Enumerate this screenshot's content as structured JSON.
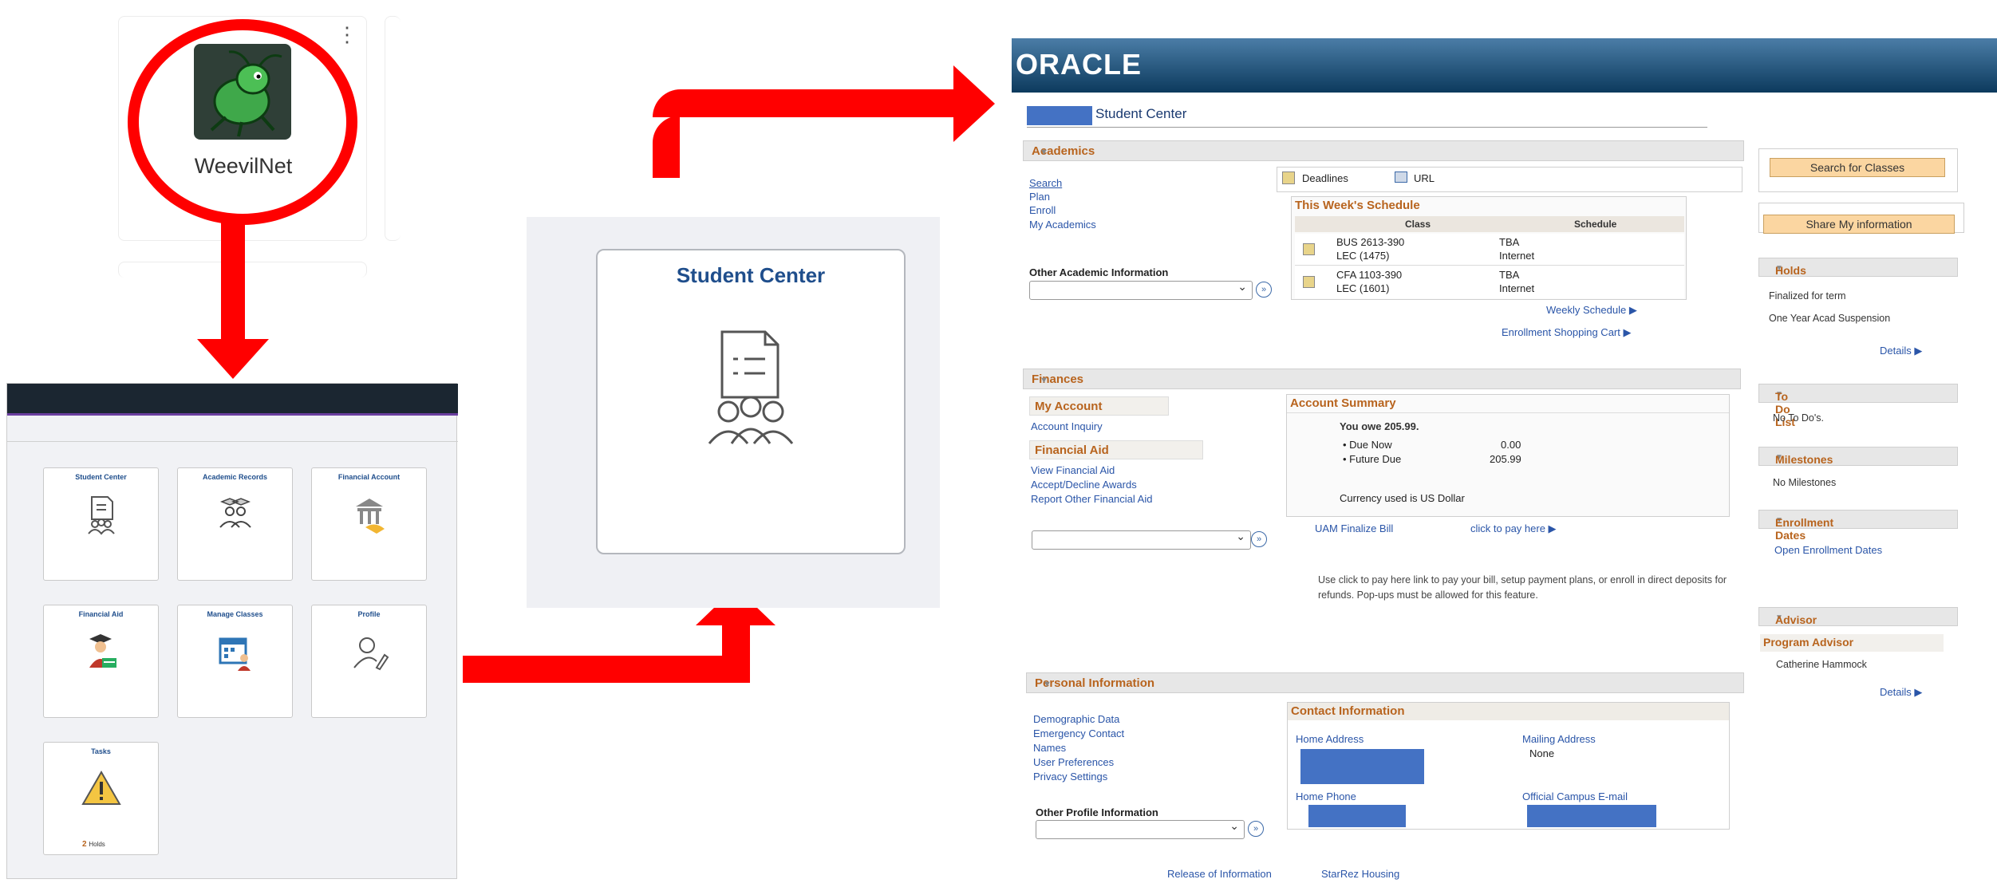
{
  "app_launcher": {
    "app_name": "WeevilNet"
  },
  "fluid_home": {
    "tiles": [
      {
        "title": "Student Center"
      },
      {
        "title": "Academic Records"
      },
      {
        "title": "Financial Account"
      },
      {
        "title": "Financial Aid"
      },
      {
        "title": "Manage Classes"
      },
      {
        "title": "Profile"
      },
      {
        "title": "Tasks",
        "count": "2",
        "count_label": "Holds"
      }
    ]
  },
  "middle_card": {
    "title": "Student Center"
  },
  "oracle": {
    "logo": "ORACLE",
    "page_title": "Student Center",
    "academics": {
      "header": "Academics",
      "links": [
        "Search",
        "Plan",
        "Enroll",
        "My Academics"
      ],
      "deadlines": "Deadlines",
      "url": "URL",
      "schedule_title": "This Week's Schedule",
      "col_class": "Class",
      "col_schedule": "Schedule",
      "rows": [
        {
          "class1": "BUS 2613-390",
          "class2": "LEC (1475)",
          "sched1": "TBA",
          "sched2": "Internet"
        },
        {
          "class1": "CFA 1103-390",
          "class2": "LEC (1601)",
          "sched1": "TBA",
          "sched2": "Internet"
        }
      ],
      "weekly_schedule": "Weekly Schedule",
      "shopping_cart": "Enrollment Shopping Cart",
      "other_label": "Other Academic Information"
    },
    "finances": {
      "header": "Finances",
      "my_account": "My Account",
      "account_inquiry": "Account Inquiry",
      "financial_aid": "Financial Aid",
      "aid_links": [
        "View Financial Aid",
        "Accept/Decline Awards",
        "Report Other Financial Aid"
      ],
      "summary_title": "Account Summary",
      "you_owe": "You owe 205.99.",
      "due_now_label": "Due Now",
      "due_now": "0.00",
      "future_due_label": "Future Due",
      "future_due": "205.99",
      "currency": "Currency used is US Dollar",
      "finalize": "UAM Finalize Bill",
      "click_pay": "click to pay here",
      "note": "Use click to pay here link to pay your bill, setup payment plans, or enroll in direct deposits for refunds. Pop-ups must be allowed for this feature."
    },
    "personal": {
      "header": "Personal Information",
      "links": [
        "Demographic Data",
        "Emergency Contact",
        "Names",
        "User Preferences",
        "Privacy Settings"
      ],
      "other_label": "Other Profile Information",
      "contact_title": "Contact Information",
      "home_address": "Home Address",
      "mailing_address": "Mailing Address",
      "mailing_value": "None",
      "home_phone": "Home Phone",
      "campus_email": "Official Campus E-mail",
      "release": "Release of Information",
      "starrez": "StarRez Housing"
    },
    "sidebar": {
      "search_btn": "Search for Classes",
      "share_btn": "Share My information",
      "holds": {
        "header": "Holds",
        "items": [
          "Finalized for term",
          "One Year Acad Suspension"
        ],
        "details": "Details"
      },
      "todo": {
        "header": "To Do List",
        "text": "No To Do's."
      },
      "milestones": {
        "header": "Milestones",
        "text": "No Milestones"
      },
      "enroll": {
        "header": "Enrollment Dates",
        "link": "Open Enrollment Dates"
      },
      "advisor": {
        "header": "Advisor",
        "sub": "Program Advisor",
        "name": "Catherine Hammock",
        "details": "Details"
      }
    }
  },
  "colors": {
    "arrow": "#ff0000",
    "accent_orange": "#b8641e",
    "link_blue": "#2a55a8",
    "oracle_bar": "#0c3a5d",
    "redaction": "#4472c4"
  }
}
